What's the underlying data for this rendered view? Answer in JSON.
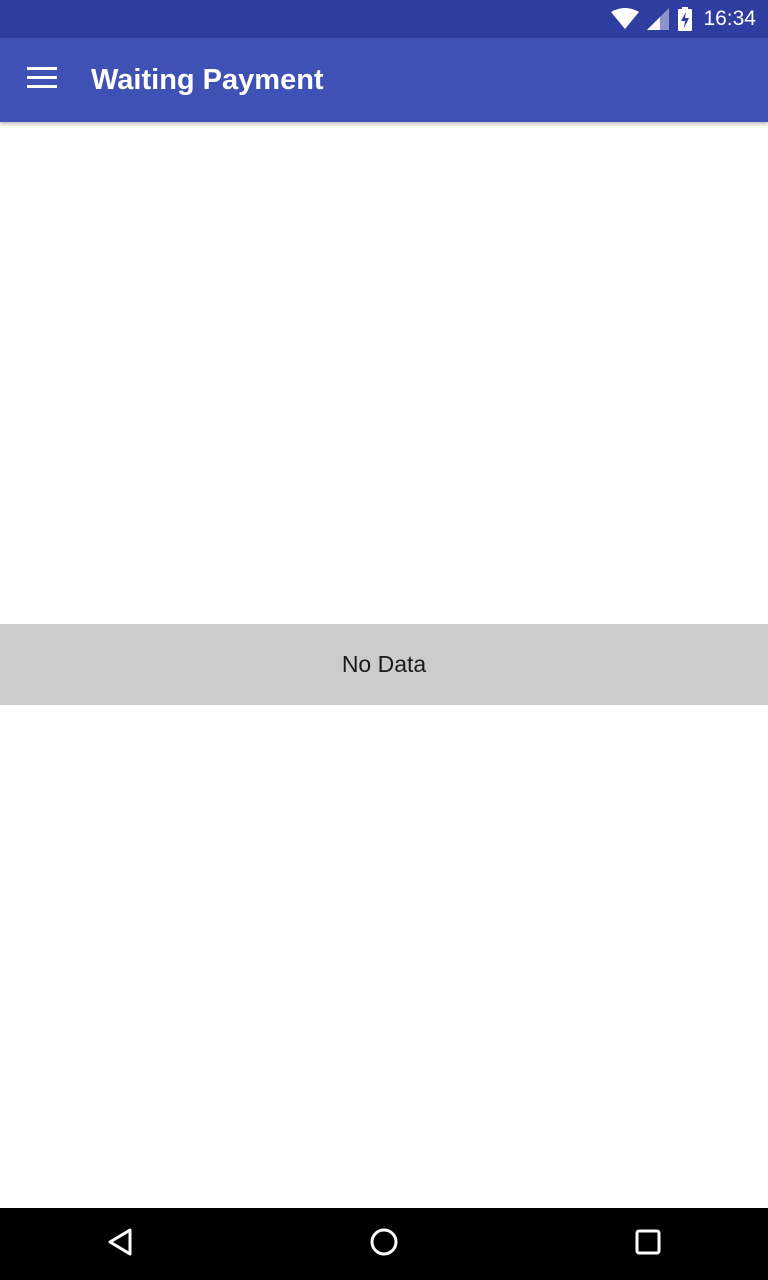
{
  "status_bar": {
    "time": "16:34",
    "background": "#2F3DA0",
    "icons": [
      "wifi-icon",
      "cell-signal-icon",
      "battery-charging-icon"
    ]
  },
  "app_bar": {
    "title": "Waiting Payment",
    "background": "#3F51B5",
    "menu_icon": "hamburger-menu-icon"
  },
  "content": {
    "empty_message": "No Data",
    "empty_banner_color": "#CCCCCC"
  },
  "nav_bar": {
    "buttons": [
      "back-icon",
      "home-icon",
      "recents-icon"
    ]
  }
}
